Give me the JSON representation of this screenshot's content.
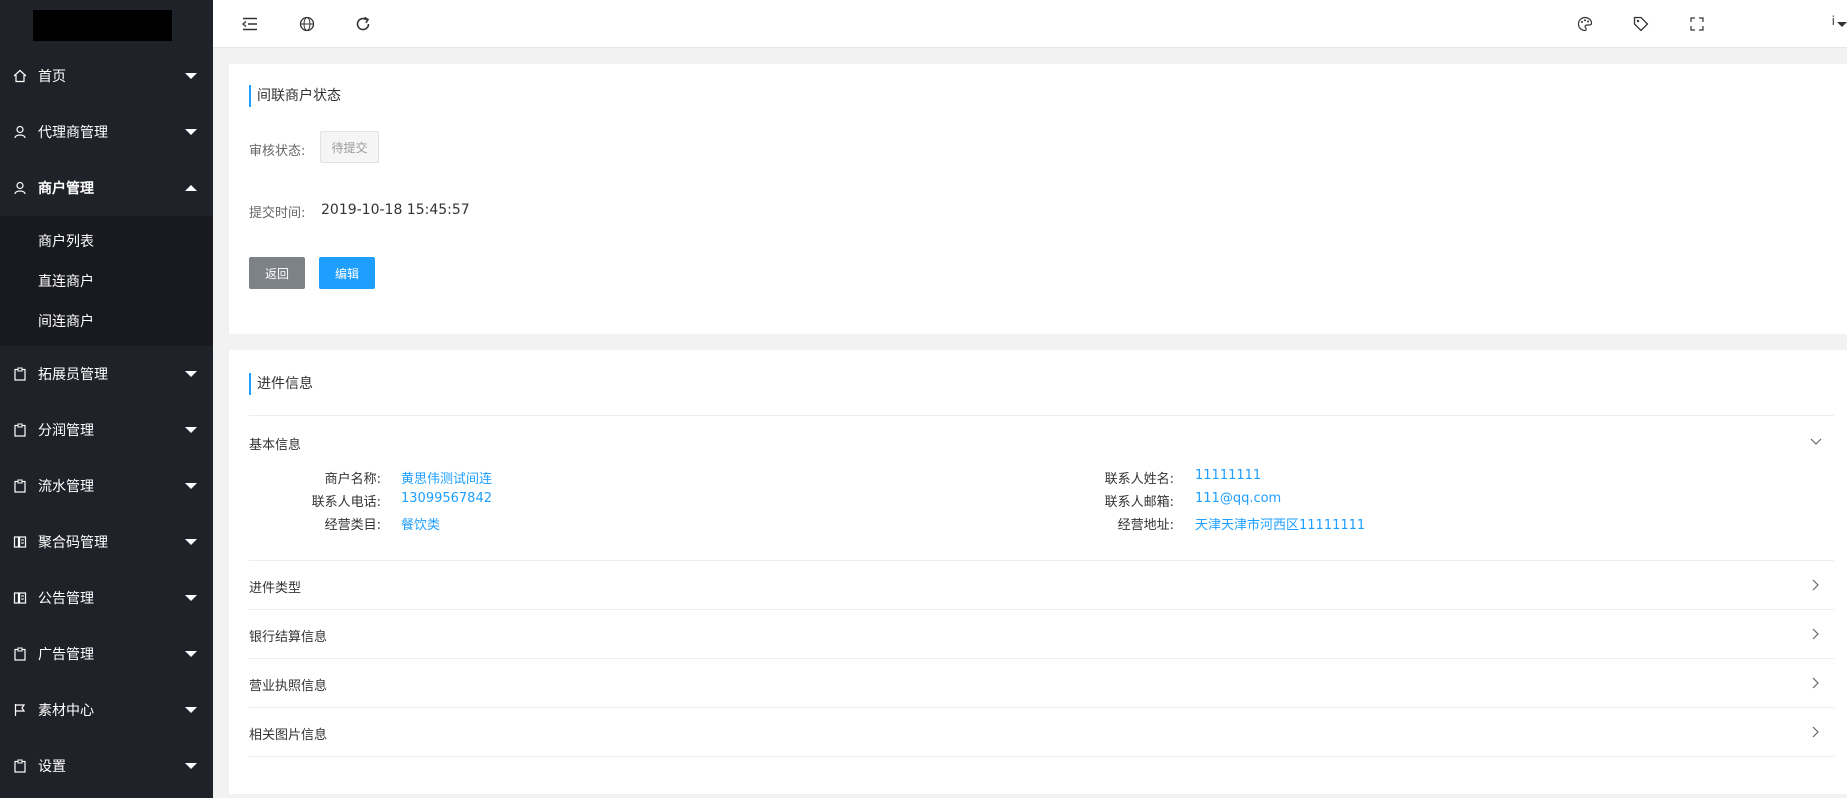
{
  "sidebar": {
    "items": [
      {
        "label": "首页",
        "icon": "home-icon"
      },
      {
        "label": "代理商管理",
        "icon": "user-icon"
      },
      {
        "label": "商户管理",
        "icon": "user-icon"
      },
      {
        "label": "拓展员管理",
        "icon": "clipboard-icon"
      },
      {
        "label": "分润管理",
        "icon": "clipboard-icon"
      },
      {
        "label": "流水管理",
        "icon": "clipboard-icon"
      },
      {
        "label": "聚合码管理",
        "icon": "book-icon"
      },
      {
        "label": "公告管理",
        "icon": "book-icon"
      },
      {
        "label": "广告管理",
        "icon": "clipboard-icon"
      },
      {
        "label": "素材中心",
        "icon": "flag-icon"
      },
      {
        "label": "设置",
        "icon": "clipboard-icon"
      }
    ],
    "submenu": [
      "商户列表",
      "直连商户",
      "间连商户"
    ]
  },
  "topbar": {
    "icons": [
      "menu-collapse-icon",
      "website-icon",
      "refresh-icon",
      "theme-palette-icon",
      "tag-icon",
      "fullscreen-icon"
    ],
    "username_hint": "i"
  },
  "status_card": {
    "title": "间联商户状态",
    "audit_label": "审核状态:",
    "audit_value": "待提交",
    "submit_label": "提交时间:",
    "submit_value": "2019-10-18 15:45:57",
    "back_button": "返回",
    "edit_button": "编辑"
  },
  "info_card": {
    "title": "进件信息",
    "basic_section": "基本信息",
    "fields": {
      "merchant_name_label": "商户名称:",
      "merchant_name": "黄思伟测试间连",
      "contact_phone_label": "联系人电话:",
      "contact_phone": "13099567842",
      "category_label": "经营类目:",
      "category": "餐饮类",
      "contact_name_label": "联系人姓名:",
      "contact_name": "11111111",
      "contact_email_label": "联系人邮箱:",
      "contact_email": "111@qq.com",
      "address_label": "经营地址:",
      "address": "天津天津市河西区11111111"
    },
    "sections": [
      "进件类型",
      "银行结算信息",
      "营业执照信息",
      "相关图片信息"
    ]
  },
  "colors": {
    "sidebar_bg": "#20222a",
    "accent": "#1e9fff",
    "back_button": "#7d8188"
  }
}
